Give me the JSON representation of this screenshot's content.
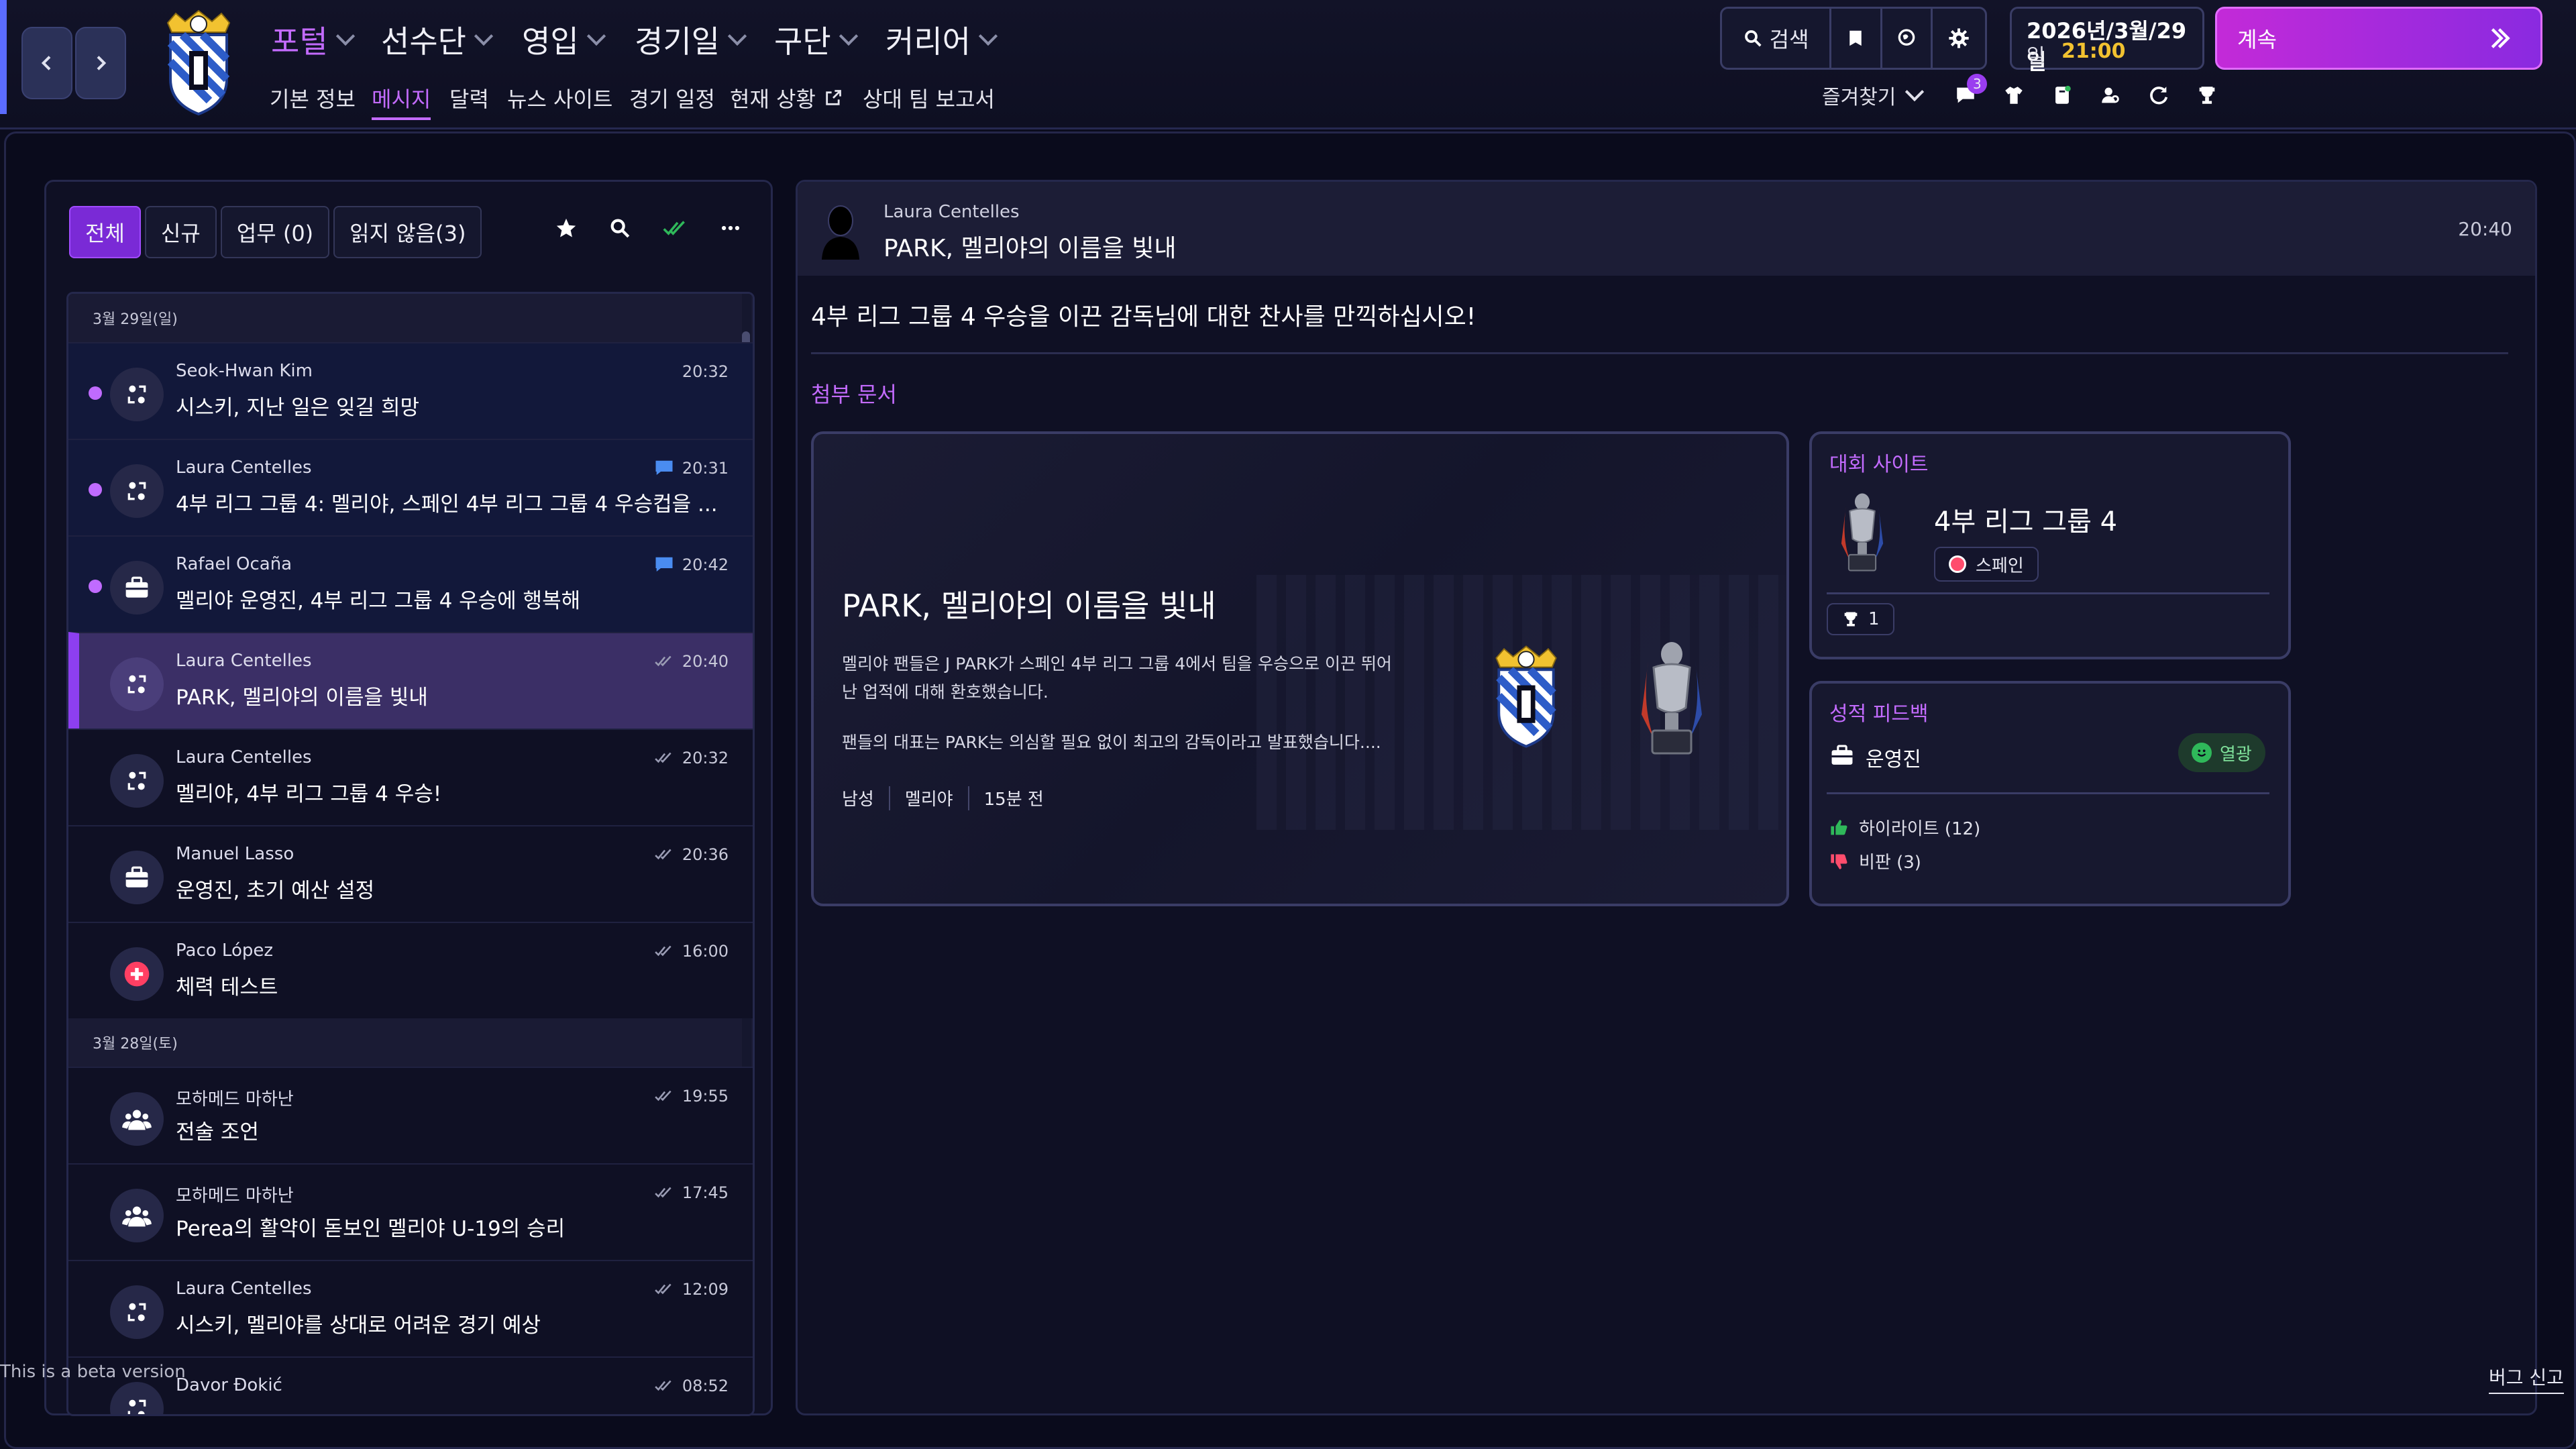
{
  "nav": {
    "menu": [
      {
        "label": "포털",
        "active": true
      },
      {
        "label": "선수단",
        "active": false
      },
      {
        "label": "영입",
        "active": false
      },
      {
        "label": "경기일",
        "active": false
      },
      {
        "label": "구단",
        "active": false
      },
      {
        "label": "커리어",
        "active": false
      }
    ],
    "submenu": [
      {
        "label": "기본 정보",
        "active": false
      },
      {
        "label": "메시지",
        "active": true
      },
      {
        "label": "달력",
        "active": false
      },
      {
        "label": "뉴스 사이트",
        "active": false
      },
      {
        "label": "경기 일정",
        "active": false
      },
      {
        "label": "현재 상황",
        "active": false
      },
      {
        "label": "상대 팀 보고서",
        "active": false
      }
    ],
    "search_label": "검색",
    "date_line": "2026년/3월/29일",
    "date_weekday": "일",
    "time": "21:00",
    "continue_label": "계속",
    "favorites_label": "즐겨찾기",
    "notification_count": "3"
  },
  "inbox": {
    "filters": [
      "전체",
      "신규",
      "업무 (0)",
      "읽지 않음(3)"
    ],
    "groups": [
      {
        "date": "3월 29일(일)",
        "messages": [
          {
            "sender": "Seok-Hwan Kim",
            "subject": "시스키, 지난 일은 잊길 희망",
            "time": "20:32",
            "unread": true,
            "icon": "transfer-icon",
            "chat": false,
            "read_check": false
          },
          {
            "sender": "Laura Centelles",
            "subject": "4부 리그 그룹 4: 멜리야, 스페인 4부 리그 그룹 4 우승컵을 ...",
            "time": "20:31",
            "unread": true,
            "icon": "transfer-icon",
            "chat": true,
            "read_check": false
          },
          {
            "sender": "Rafael Ocaña",
            "subject": "멜리야 운영진, 4부 리그 그룹 4 우승에 행복해",
            "time": "20:42",
            "unread": true,
            "icon": "briefcase-icon",
            "chat": true,
            "read_check": false
          },
          {
            "sender": "Laura Centelles",
            "subject": "PARK, 멜리야의 이름을 빛내",
            "time": "20:40",
            "selected": true,
            "icon": "transfer-icon",
            "chat": false,
            "read_check": true
          },
          {
            "sender": "Laura Centelles",
            "subject": "멜리야, 4부 리그 그룹 4 우승!",
            "time": "20:32",
            "icon": "transfer-icon",
            "chat": false,
            "read_check": true
          },
          {
            "sender": "Manuel Lasso",
            "subject": "운영진, 초기 예산 설정",
            "time": "20:36",
            "icon": "briefcase-icon",
            "chat": false,
            "read_check": true
          },
          {
            "sender": "Paco López",
            "subject": "체력 테스트",
            "time": "16:00",
            "icon": "medical-icon",
            "chat": false,
            "read_check": true
          }
        ]
      },
      {
        "date": "3월 28일(토)",
        "messages": [
          {
            "sender": "모하메드 마하난",
            "subject": "전술 조언",
            "time": "19:55",
            "icon": "staff-icon",
            "chat": false,
            "read_check": true
          },
          {
            "sender": "모하메드 마하난",
            "subject": "Perea의 활약이 돋보인 멜리야 U-19의 승리",
            "time": "17:45",
            "icon": "staff-icon",
            "chat": false,
            "read_check": true
          },
          {
            "sender": "Laura Centelles",
            "subject": "시스키, 멜리야를 상대로 어려운 경기 예상",
            "time": "12:09",
            "icon": "transfer-icon",
            "chat": false,
            "read_check": true
          },
          {
            "sender": "Davor Đokić",
            "subject": "",
            "time": "08:52",
            "icon": "transfer-icon",
            "chat": false,
            "read_check": true
          }
        ]
      }
    ]
  },
  "detail": {
    "sender": "Laura Centelles",
    "subject": "PARK, 멜리야의 이름을 빛내",
    "time": "20:40",
    "body": "4부 리그 그룹 4 우승을 이끈 감독님에 대한 찬사를 만끽하십시오!",
    "attachments_label": "첨부 문서",
    "news": {
      "headline": "PARK, 멜리야의 이름을 빛내",
      "para1": "멜리야 팬들은 J PARK가 스페인 4부 리그 그룹 4에서 팀을 우승으로 이끈 뛰어난 업적에 대해 환호했습니다.",
      "para2": "팬들의 대표는 PARK는 의심할 필요 없이 최고의 감독이라고 발표했습니다....",
      "tags": [
        "남성",
        "멜리야",
        "15분 전"
      ]
    },
    "competition": {
      "title": "대회 사이트",
      "name": "4부 리그 그룹 4",
      "country": "스페인",
      "trophies": "1"
    },
    "feedback": {
      "title": "성적 피드백",
      "group": "운영진",
      "status": "열광",
      "highlights": "하이라이트 (12)",
      "criticism": "비판 (3)"
    }
  },
  "footer": {
    "beta": "This is a beta version",
    "bug_report": "버그 신고"
  },
  "colors": {
    "accent": "#c36bff",
    "selected": "#3b2f66",
    "continue_start": "#c32ad8",
    "continue_end": "#8a2ae0",
    "positive": "#2fb85a",
    "negative": "#ff4d6d"
  }
}
